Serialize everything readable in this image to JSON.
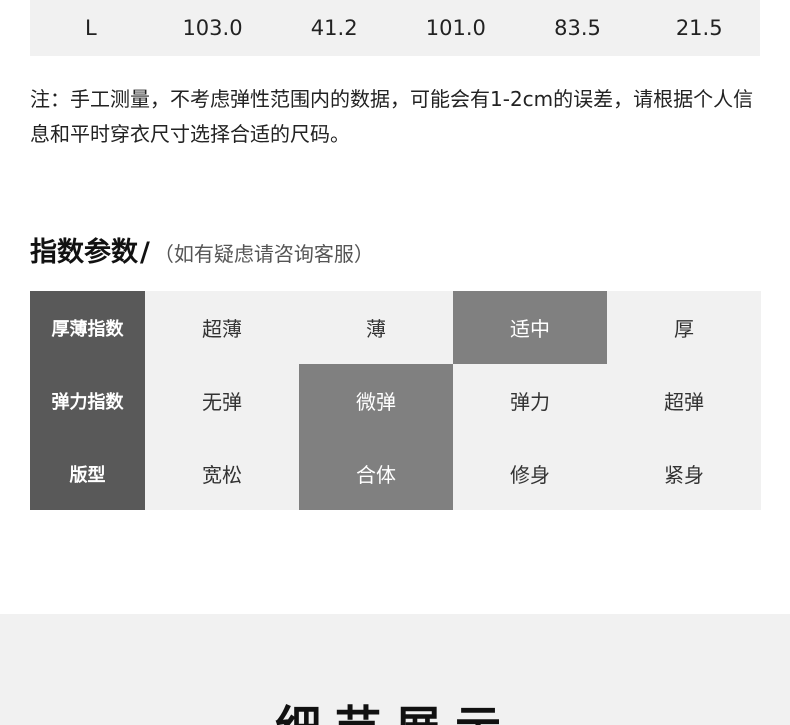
{
  "size_row": {
    "size": "L",
    "values": [
      "103.0",
      "41.2",
      "101.0",
      "83.5",
      "21.5"
    ]
  },
  "note": "注：手工测量，不考虑弹性范围内的数据，可能会有1-2cm的误差，请根据个人信息和平时穿衣尺寸选择合适的尺码。",
  "index_section": {
    "title": "指数参数",
    "slash": "/",
    "subtitle": "（如有疑虑请咨询客服）",
    "rows": [
      {
        "label": "厚薄指数",
        "options": [
          "超薄",
          "薄",
          "适中",
          "厚"
        ],
        "selected": 2
      },
      {
        "label": "弹力指数",
        "options": [
          "无弹",
          "微弹",
          "弹力",
          "超弹"
        ],
        "selected": 1
      },
      {
        "label": "版型",
        "options": [
          "宽松",
          "合体",
          "修身",
          "紧身"
        ],
        "selected": 1
      }
    ]
  },
  "detail_section": {
    "title": "细节展示"
  },
  "colors": {
    "label_bg": "#595959",
    "selected_bg": "#808080",
    "row_bg": "#f1f1f1"
  }
}
